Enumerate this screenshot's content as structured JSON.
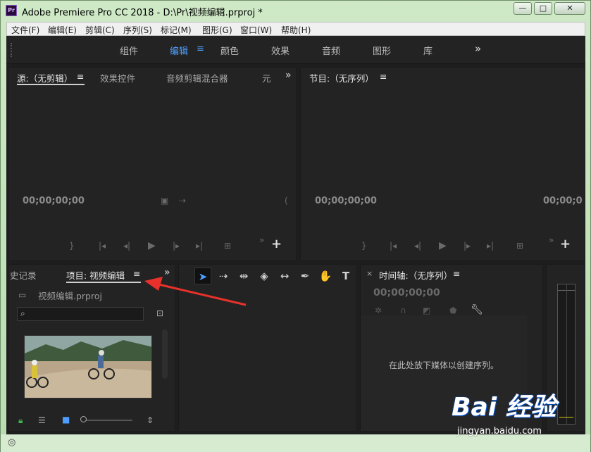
{
  "window": {
    "app_icon": "Pr",
    "title": "Adobe Premiere Pro CC 2018 - D:\\Pr\\视频编辑.prproj *",
    "minimize": "—",
    "maximize": "□",
    "close": "✕"
  },
  "menu": [
    "文件(F)",
    "编辑(E)",
    "剪辑(C)",
    "序列(S)",
    "标记(M)",
    "图形(G)",
    "窗口(W)",
    "帮助(H)"
  ],
  "workspaces": {
    "tabs": [
      "组件",
      "编辑",
      "颜色",
      "效果",
      "音频",
      "图形",
      "库"
    ],
    "active": "编辑",
    "menu_icon": "≡",
    "overflow": "»"
  },
  "source_panel": {
    "tabs": [
      "源:（无剪辑）",
      "效果控件",
      "音频剪辑混合器",
      "元"
    ],
    "timecode": "00;00;00;00",
    "overflow": "»",
    "menu_icon": "≡"
  },
  "program_panel": {
    "tab": "节目:（无序列）",
    "timecode_left": "00;00;00;00",
    "timecode_right": "00;00;0",
    "menu_icon": "≡"
  },
  "project_panel": {
    "tabs": [
      "史记录",
      "项目: 视频编辑"
    ],
    "file_name": "视频编辑.prproj",
    "search_placeholder": "",
    "menu_icon": "≡",
    "overflow": "»"
  },
  "timeline_panel": {
    "close": "×",
    "tab": "时间轴:（无序列）",
    "timecode": "00;00;00;00",
    "drop_message": "在此处放下媒体以创建序列。",
    "menu_icon": "≡"
  },
  "tools": [
    "selection-tool",
    "track-select-tool",
    "ripple-edit-tool",
    "razor-tool",
    "slip-tool",
    "pen-tool",
    "hand-tool",
    "type-tool"
  ],
  "watermark": {
    "logo": "Bai 经验",
    "url": "jingyan.baidu.com"
  },
  "colors": {
    "accent": "#4d9fff",
    "arrow": "#e8312a",
    "panel_bg": "#232323"
  }
}
